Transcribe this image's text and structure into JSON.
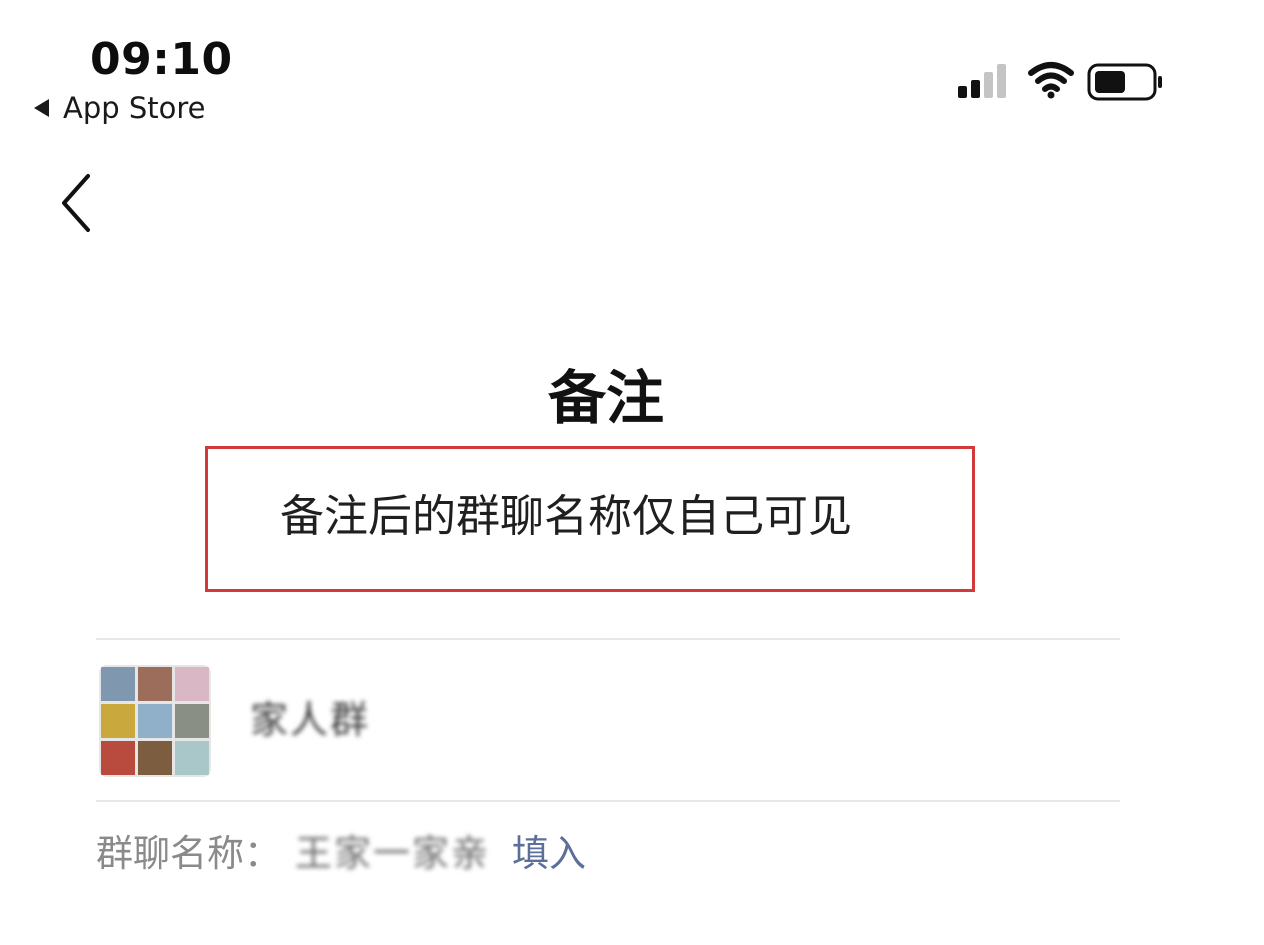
{
  "status_bar": {
    "time": "09:10",
    "back_app": "App Store"
  },
  "page": {
    "title": "备注",
    "hint": "备注后的群聊名称仅自己可见"
  },
  "group": {
    "name": "家人群",
    "avatar_colors": [
      "#7f98b0",
      "#9b6d5a",
      "#d9b7c4",
      "#c9a93d",
      "#8fb0c8",
      "#8a8f86",
      "#b94a3e",
      "#7d5d3f",
      "#a9c6c9"
    ]
  },
  "chat_name": {
    "label": "群聊名称：",
    "value": "王家一家亲",
    "fill_in_label": "填入"
  }
}
